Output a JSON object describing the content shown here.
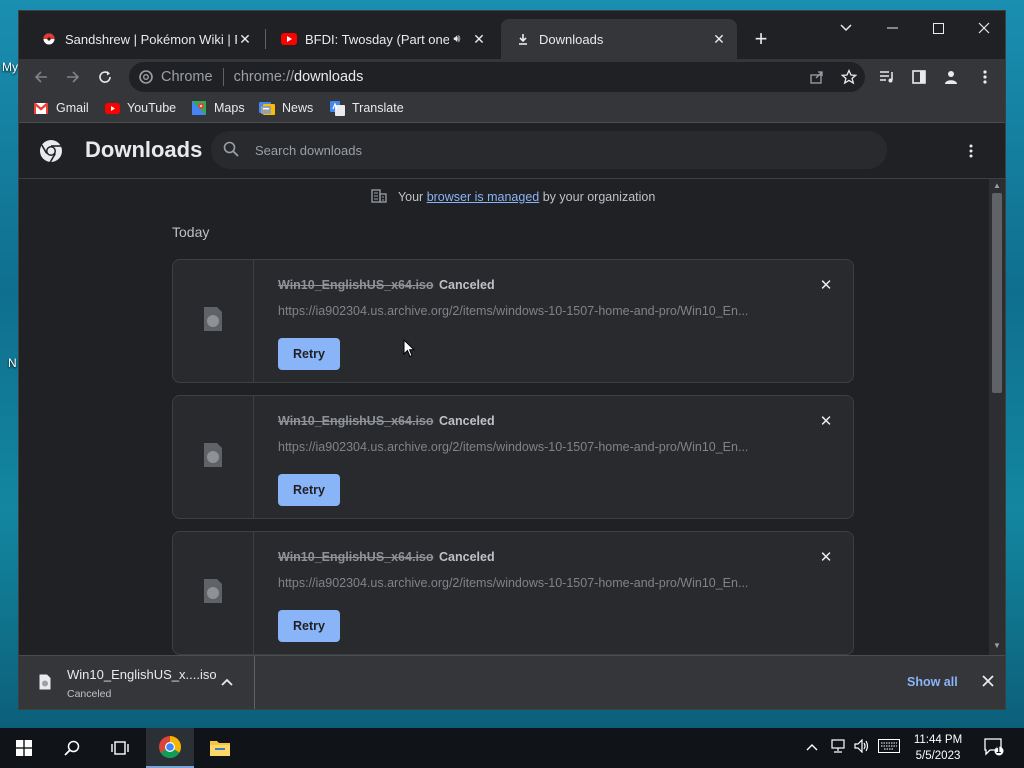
{
  "desktop": {
    "icon_labels": [
      "My",
      "N"
    ]
  },
  "tabs": [
    {
      "title": "Sandshrew | Pokémon Wiki | Fan",
      "favicon": "pokeball-icon"
    },
    {
      "title": "BFDI: Twosday (Part one of T",
      "favicon": "youtube-icon",
      "muted_icon": "speaker-icon"
    },
    {
      "title": "Downloads",
      "favicon": "download-icon",
      "active": true
    }
  ],
  "address": {
    "scheme": "chrome://",
    "host": "downloads",
    "chip": "Chrome"
  },
  "bookmarks": [
    {
      "label": "Gmail",
      "icon": "gmail-icon"
    },
    {
      "label": "YouTube",
      "icon": "youtube-icon"
    },
    {
      "label": "Maps",
      "icon": "maps-icon"
    },
    {
      "label": "News",
      "icon": "news-icon"
    },
    {
      "label": "Translate",
      "icon": "translate-icon"
    }
  ],
  "page": {
    "title": "Downloads",
    "search_placeholder": "Search downloads",
    "managed_prefix": "Your",
    "managed_link": "browser is managed",
    "managed_suffix": "by your organization",
    "section": "Today"
  },
  "downloads": [
    {
      "filename": "Win10_EnglishUS_x64.iso",
      "status": "Canceled",
      "url": "https://ia902304.us.archive.org/2/items/windows-10-1507-home-and-pro/Win10_En...",
      "action": "Retry"
    },
    {
      "filename": "Win10_EnglishUS_x64.iso",
      "status": "Canceled",
      "url": "https://ia902304.us.archive.org/2/items/windows-10-1507-home-and-pro/Win10_En...",
      "action": "Retry"
    },
    {
      "filename": "Win10_EnglishUS_x64.iso",
      "status": "Canceled",
      "url": "https://ia902304.us.archive.org/2/items/windows-10-1507-home-and-pro/Win10_En...",
      "action": "Retry"
    }
  ],
  "shelf": {
    "filename": "Win10_EnglishUS_x....iso",
    "status": "Canceled",
    "show_all": "Show all"
  },
  "taskbar": {
    "time": "11:44 PM",
    "date": "5/5/2023",
    "notification_count": "1"
  },
  "colors": {
    "accent": "#8ab4f8",
    "background": "#202124",
    "card": "#292a2d"
  }
}
